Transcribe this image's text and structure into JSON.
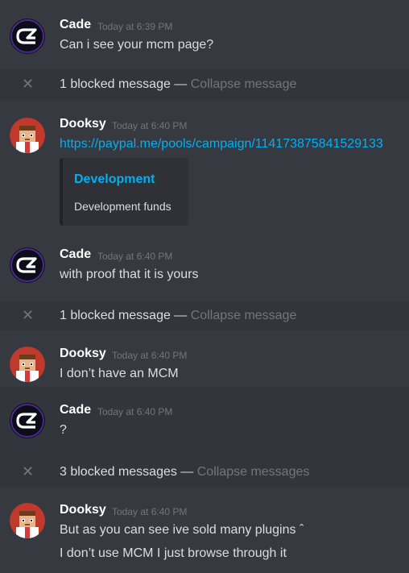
{
  "messages": [
    {
      "author": "Cade",
      "time": "Today at 6:39 PM",
      "text": "Can i see your mcm page?"
    },
    {
      "blocked": "1 blocked message",
      "sep": " — ",
      "collapse": "Collapse message"
    },
    {
      "author": "Dooksy",
      "time": "Today at 6:40 PM",
      "link": "https://paypal.me/pools/campaign/114173875841529133",
      "embed": {
        "title": "Development",
        "description": "Development funds"
      }
    },
    {
      "author": "Cade",
      "time": "Today at 6:40 PM",
      "text": "with proof that it is yours"
    },
    {
      "blocked": "1 blocked message",
      "sep": " — ",
      "collapse": "Collapse message"
    },
    {
      "author": "Dooksy",
      "time": "Today at 6:40 PM",
      "text": "I don’t have an MCM"
    },
    {
      "author": "Cade",
      "time": "Today at 6:40 PM",
      "text": "?"
    },
    {
      "blocked": "3 blocked messages",
      "sep": " — ",
      "collapse": "Collapse messages"
    },
    {
      "author": "Dooksy",
      "time": "Today at 6:40 PM",
      "text": "But as you can see ive sold many plugins ˆ",
      "text2": "I don’t use MCM I just browse through it"
    }
  ],
  "icons": {
    "blocked": "close-icon",
    "cade_avatar": "cade-logo-avatar",
    "dooksy_avatar": "dooksy-pixel-avatar"
  },
  "colors": {
    "background": "#36393f",
    "link": "#00b0f4",
    "muted": "#72767d",
    "text": "#dcddde"
  }
}
